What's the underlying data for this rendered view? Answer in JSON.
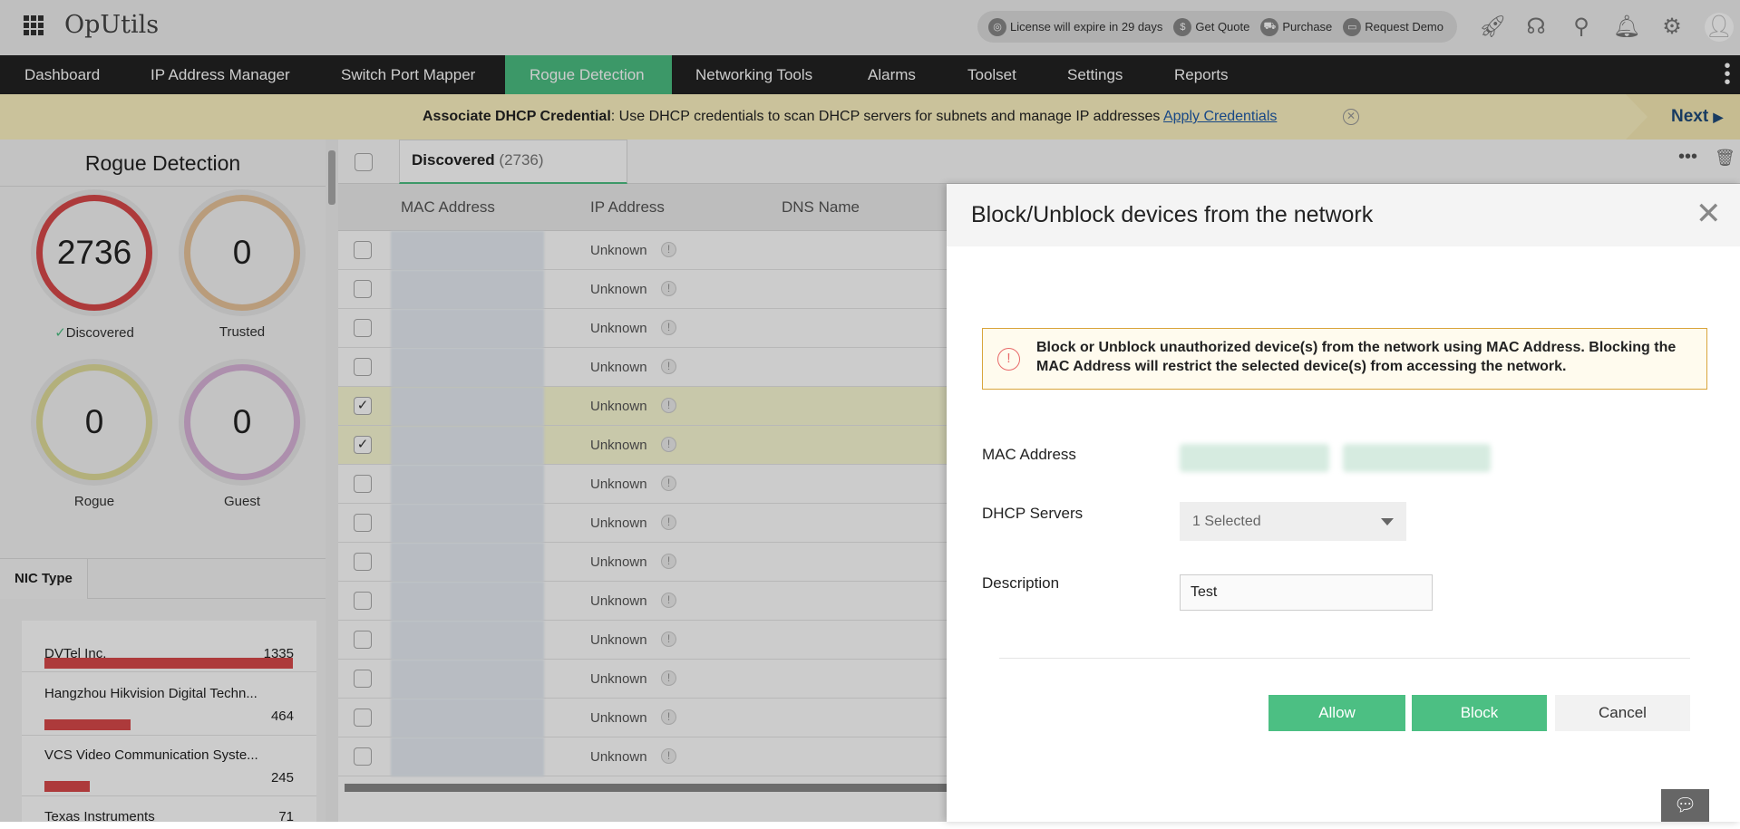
{
  "app": {
    "title": "OpUtils"
  },
  "header": {
    "license": "License will expire in 29 days",
    "get_quote": "Get Quote",
    "purchase": "Purchase",
    "request_demo": "Request Demo",
    "icons": [
      "rocket-icon",
      "headset-icon",
      "search-icon",
      "bell-icon",
      "gear-icon",
      "user-avatar-icon"
    ]
  },
  "nav": {
    "items": [
      "Dashboard",
      "IP Address Manager",
      "Switch Port Mapper",
      "Rogue Detection",
      "Networking Tools",
      "Alarms",
      "Toolset",
      "Settings",
      "Reports"
    ],
    "active": "Rogue Detection"
  },
  "banner": {
    "title": "Associate DHCP Credential",
    "text": ": Use DHCP credentials to scan DHCP servers for subnets and manage IP addresses ",
    "link": "Apply Credentials",
    "next": "Next"
  },
  "sidebar": {
    "title": "Rogue Detection",
    "stats": [
      {
        "label": "Discovered",
        "value": "2736",
        "color": "#d9494a",
        "checked": true
      },
      {
        "label": "Trusted",
        "value": "0",
        "color": "#e8c39a"
      },
      {
        "label": "Rogue",
        "value": "0",
        "color": "#e0dc9a"
      },
      {
        "label": "Guest",
        "value": "0",
        "color": "#d9b3d9"
      }
    ],
    "nic_tab": "NIC Type",
    "nic_items": [
      {
        "name": "DVTel Inc.",
        "count": "1335",
        "value": 1335
      },
      {
        "name": "Hangzhou Hikvision Digital Techn...",
        "count": "464",
        "value": 464
      },
      {
        "name": "VCS Video Communication Syste...",
        "count": "245",
        "value": 245
      },
      {
        "name": "Texas Instruments",
        "count": "71",
        "value": 71
      }
    ]
  },
  "table": {
    "tab_label": "Discovered",
    "tab_count": "(2736)",
    "columns": [
      "MAC Address",
      "IP Address",
      "DNS Name"
    ],
    "rows": [
      {
        "ip": "Unknown",
        "checked": false
      },
      {
        "ip": "Unknown",
        "checked": false
      },
      {
        "ip": "Unknown",
        "checked": false
      },
      {
        "ip": "Unknown",
        "checked": false
      },
      {
        "ip": "Unknown",
        "checked": true
      },
      {
        "ip": "Unknown",
        "checked": true
      },
      {
        "ip": "Unknown",
        "checked": false
      },
      {
        "ip": "Unknown",
        "checked": false
      },
      {
        "ip": "Unknown",
        "checked": false
      },
      {
        "ip": "Unknown",
        "checked": false
      },
      {
        "ip": "Unknown",
        "checked": false
      },
      {
        "ip": "Unknown",
        "checked": false
      },
      {
        "ip": "Unknown",
        "checked": false
      },
      {
        "ip": "Unknown",
        "checked": false
      }
    ]
  },
  "modal": {
    "title": "Block/Unblock devices from the network",
    "alert": "Block or Unblock unauthorized device(s) from the network using MAC Address. Blocking the MAC Address will restrict the selected device(s) from accessing the network.",
    "mac_label": "MAC Address",
    "dhcp_label": "DHCP Servers",
    "dhcp_value": "1 Selected",
    "desc_label": "Description",
    "desc_value": "Test",
    "allow": "Allow",
    "block": "Block",
    "cancel": "Cancel"
  },
  "colors": {
    "accent": "#4cbf83",
    "nav_bg": "#222222",
    "banner_bg": "#fdf3c2",
    "bar": "#d9494a"
  }
}
